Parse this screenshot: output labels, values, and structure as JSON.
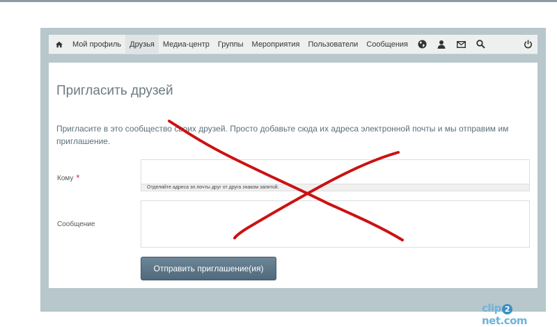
{
  "nav": {
    "items": [
      {
        "label": "Мой профиль"
      },
      {
        "label": "Друзья",
        "active": true
      },
      {
        "label": "Медиа-центр"
      },
      {
        "label": "Группы"
      },
      {
        "label": "Мероприятия"
      },
      {
        "label": "Пользователи"
      },
      {
        "label": "Сообщения"
      }
    ],
    "icons": [
      "home-icon",
      "globe-icon",
      "friend-requests-icon",
      "mail-icon",
      "search-icon",
      "power-icon"
    ]
  },
  "page": {
    "title": "Пригласить друзей",
    "intro": "Пригласите в это сообщество своих друзей. Просто добавьте сюда их адреса электронной почты и мы отправим им приглашение."
  },
  "form": {
    "to_label": "Кому",
    "required_mark": "*",
    "to_value": "",
    "to_hint": "Отделяйте адреса эл.почты друг от друга знаком запятой.",
    "message_label": "Сообщение",
    "message_value": "",
    "submit_label": "Отправить приглашение(ия)"
  },
  "watermark": {
    "before": "clip",
    "middle": "2",
    "after": "net.com"
  },
  "colors": {
    "frame": "#b7c7cb",
    "button": "#5b7587",
    "annotation": "#cc1111"
  }
}
